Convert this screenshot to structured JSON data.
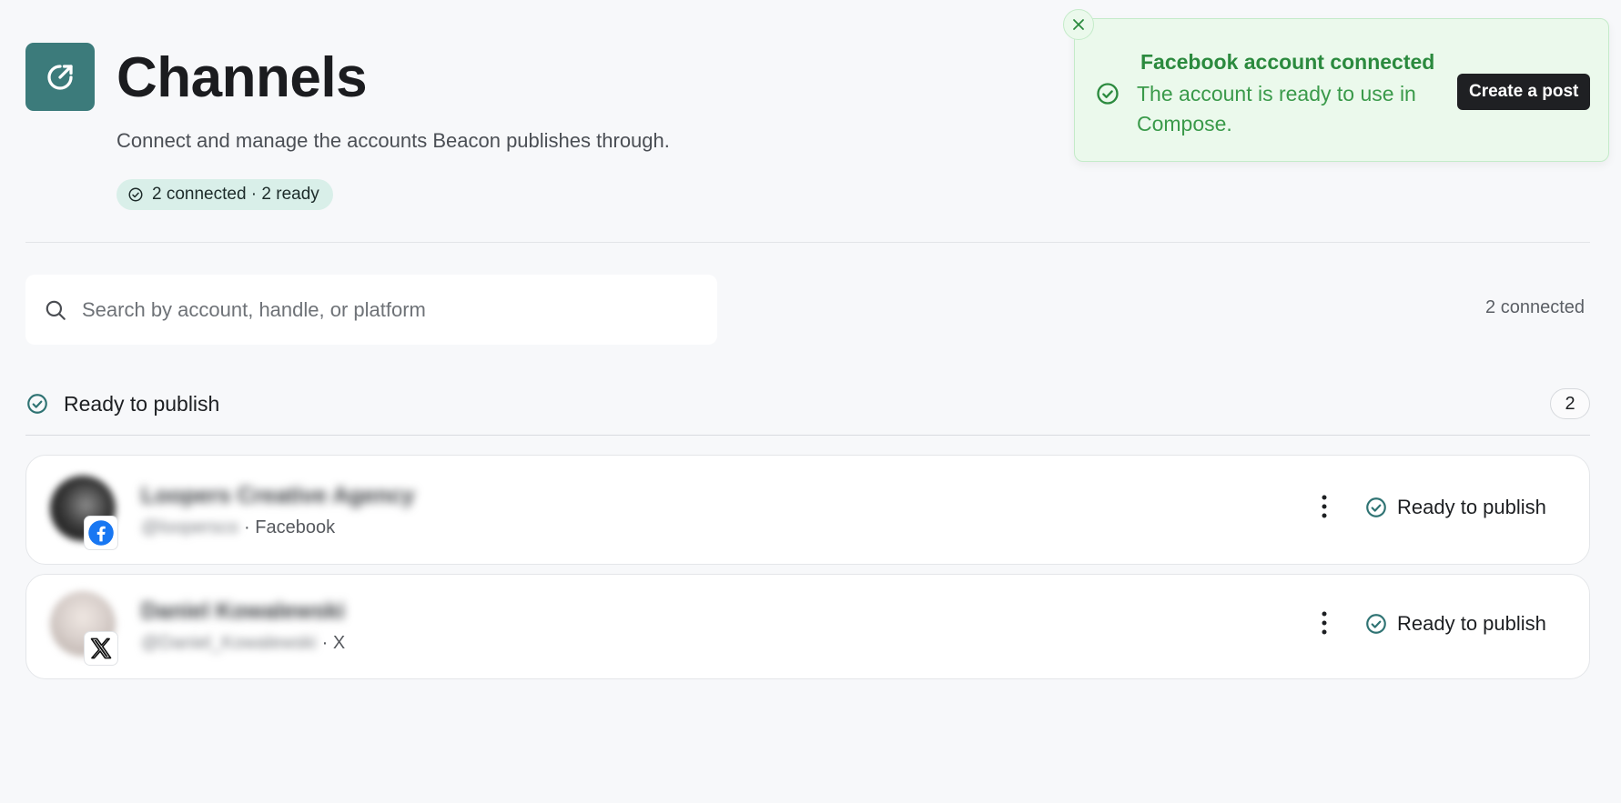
{
  "header": {
    "title": "Channels",
    "subtitle": "Connect and manage the accounts Beacon publishes through.",
    "summary_badge": "2 connected · 2 ready",
    "icon": "external-link-circle-icon"
  },
  "search": {
    "placeholder": "Search by account, handle, or platform",
    "value": "",
    "connected_count": "2 connected"
  },
  "section": {
    "title": "Ready to publish",
    "count": "2"
  },
  "channels": [
    {
      "name": "Loopers Creative Agency",
      "handle": "@loopersco",
      "platform_label": "· Facebook",
      "platform_icon": "facebook-icon",
      "status": "Ready to publish"
    },
    {
      "name": "Daniel Kowalewski",
      "handle": "@Daniel_Kowalewski",
      "platform_label": "· X",
      "platform_icon": "x-logo-icon",
      "status": "Ready to publish"
    }
  ],
  "toast": {
    "title": "Facebook account connected",
    "message": "The account is ready to use in Compose.",
    "action_label": "Create a post"
  },
  "colors": {
    "brand": "#3c7b7b",
    "success_text": "#2b8a3e",
    "success_bg": "#ebf9ec",
    "badge_bg": "#d9efe9",
    "facebook": "#1877f2"
  }
}
